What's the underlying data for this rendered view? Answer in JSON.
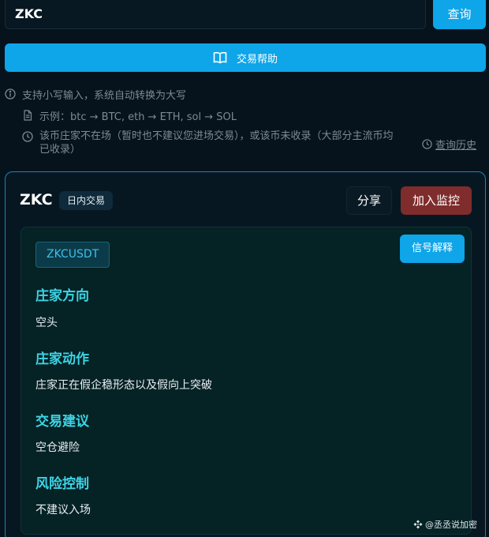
{
  "search": {
    "value": "ZKC",
    "button_label": "查询"
  },
  "help_button": {
    "label": "交易帮助",
    "icon": "book-open-icon"
  },
  "hints": {
    "case_hint": "支持小写输入，系统自动转换为大写",
    "example": "示例：btc → BTC, eth → ETH, sol → SOL",
    "absent_notice": "该币庄家不在场（暂时也不建议您进场交易），或该币未收录（大部分主流币均已收录）"
  },
  "history_link": {
    "label": "查询历史",
    "icon": "clock-icon"
  },
  "result": {
    "coin": "ZKC",
    "mode_badge": "日内交易",
    "share_label": "分享",
    "monitor_label": "加入监控",
    "symbol": "ZKCUSDT",
    "explain_label": "信号解释",
    "sections": [
      {
        "title": "庄家方向",
        "text": "空头"
      },
      {
        "title": "庄家动作",
        "text": "庄家正在假企稳形态以及假向上突破"
      },
      {
        "title": "交易建议",
        "text": "空仓避险"
      },
      {
        "title": "风险控制",
        "text": "不建议入场"
      }
    ]
  },
  "watermark": "@丞丞说加密",
  "colors": {
    "accent": "#0ea5e9",
    "section_title": "#3dd4e6",
    "monitor": "#7f2c2c",
    "background": "#06131c"
  }
}
